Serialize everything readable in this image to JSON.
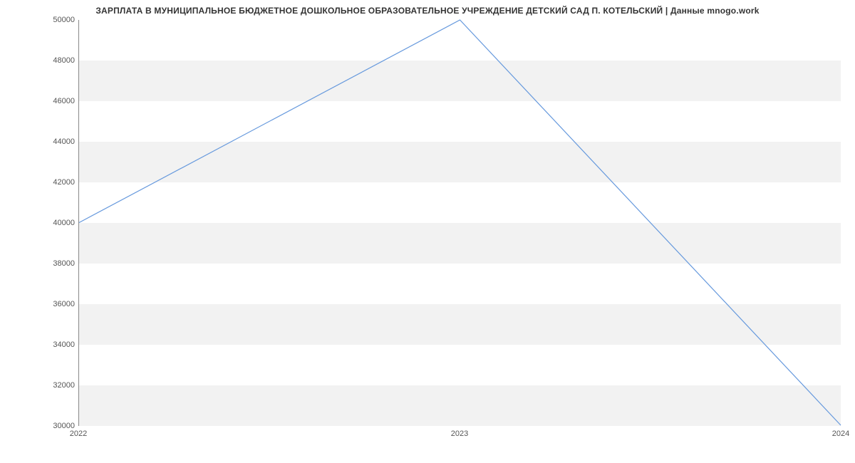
{
  "chart_data": {
    "type": "line",
    "title": "ЗАРПЛАТА В МУНИЦИПАЛЬНОЕ БЮДЖЕТНОЕ ДОШКОЛЬНОЕ ОБРАЗОВАТЕЛЬНОЕ УЧРЕЖДЕНИЕ ДЕТСКИЙ САД П. КОТЕЛЬСКИЙ | Данные mnogo.work",
    "x": [
      2022,
      2023,
      2024
    ],
    "values": [
      40000,
      50000,
      30000
    ],
    "xlabel": "",
    "ylabel": "",
    "xlim": [
      2022,
      2024
    ],
    "ylim": [
      30000,
      50000
    ],
    "x_ticks": [
      2022,
      2023,
      2024
    ],
    "y_ticks": [
      30000,
      32000,
      34000,
      36000,
      38000,
      40000,
      42000,
      44000,
      46000,
      48000,
      50000
    ],
    "grid": "horizontal-bands"
  }
}
